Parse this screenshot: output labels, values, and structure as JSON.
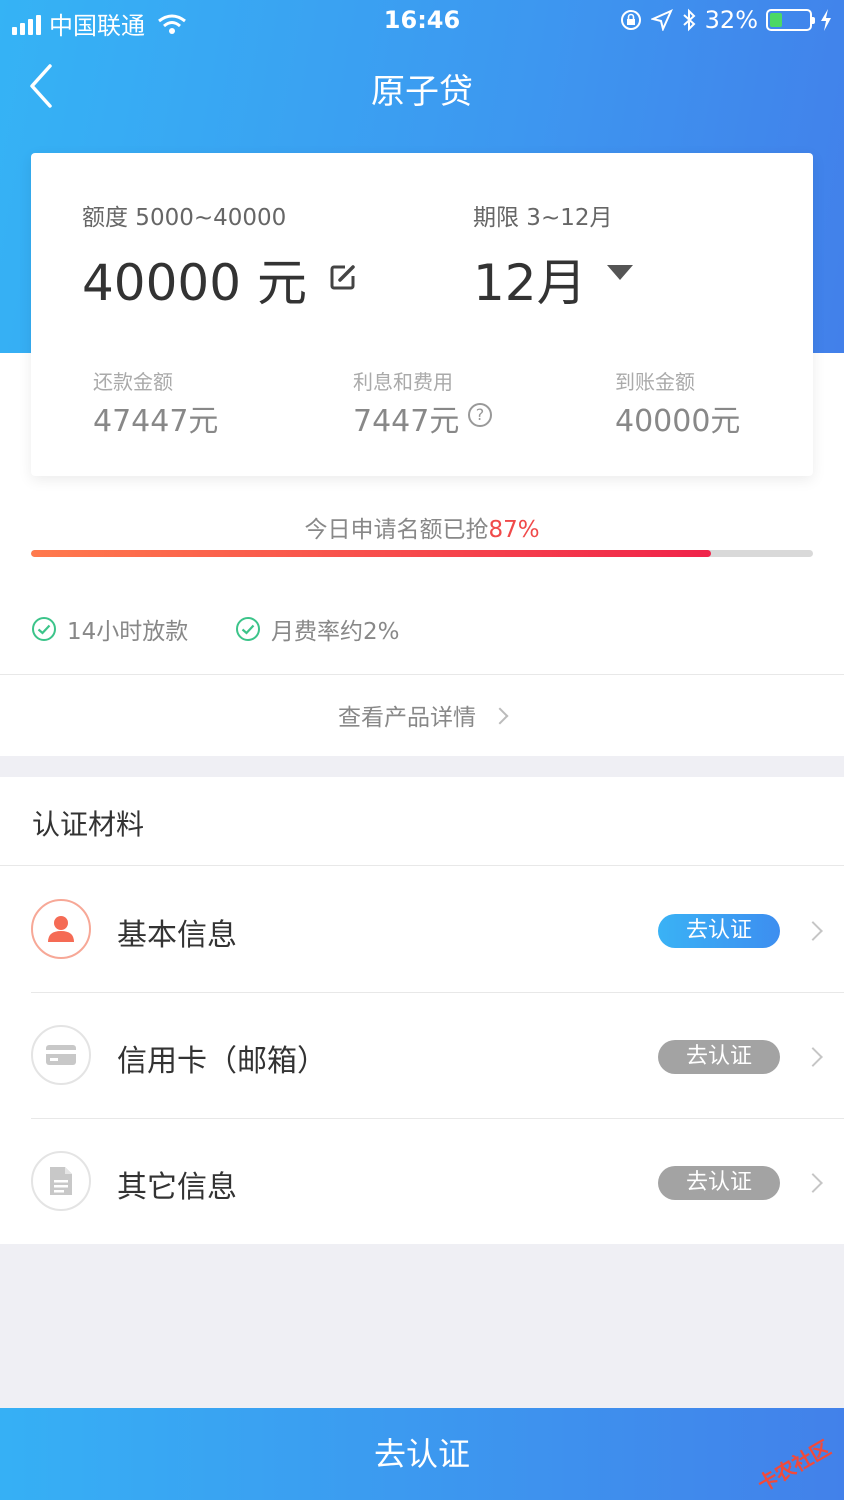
{
  "status_bar": {
    "carrier": "中国联通",
    "time": "16:46",
    "battery": "32%",
    "battery_level": 0.32
  },
  "nav": {
    "title": "原子贷"
  },
  "loan_card": {
    "amount_label": "额度 5000~40000",
    "amount_value": "40000 元",
    "term_label": "期限 3~12月",
    "term_value": "12月",
    "repay_label": "还款金额",
    "repay_value": "47447元",
    "fee_label": "利息和费用",
    "fee_value": "7447元",
    "receive_label": "到账金额",
    "receive_value": "40000元"
  },
  "progress": {
    "label": "今日申请名额已抢",
    "percent_text": "87%",
    "fraction": 0.87
  },
  "features": [
    "14小时放款",
    "月费率约2%"
  ],
  "detail_link": "查看产品详情",
  "auth": {
    "title": "认证材料",
    "items": [
      {
        "label": "基本信息",
        "button": "去认证",
        "icon": "user-icon",
        "active": true
      },
      {
        "label": "信用卡（邮箱）",
        "button": "去认证",
        "icon": "credit-card-icon",
        "active": false
      },
      {
        "label": "其它信息",
        "button": "去认证",
        "icon": "document-icon",
        "active": false
      }
    ]
  },
  "bottom_button": "去认证",
  "watermark": "卡农社区",
  "colors": {
    "brand_blue": "#3d97f0",
    "progress_red": "#f0234a",
    "check_green": "#3cc48a"
  }
}
